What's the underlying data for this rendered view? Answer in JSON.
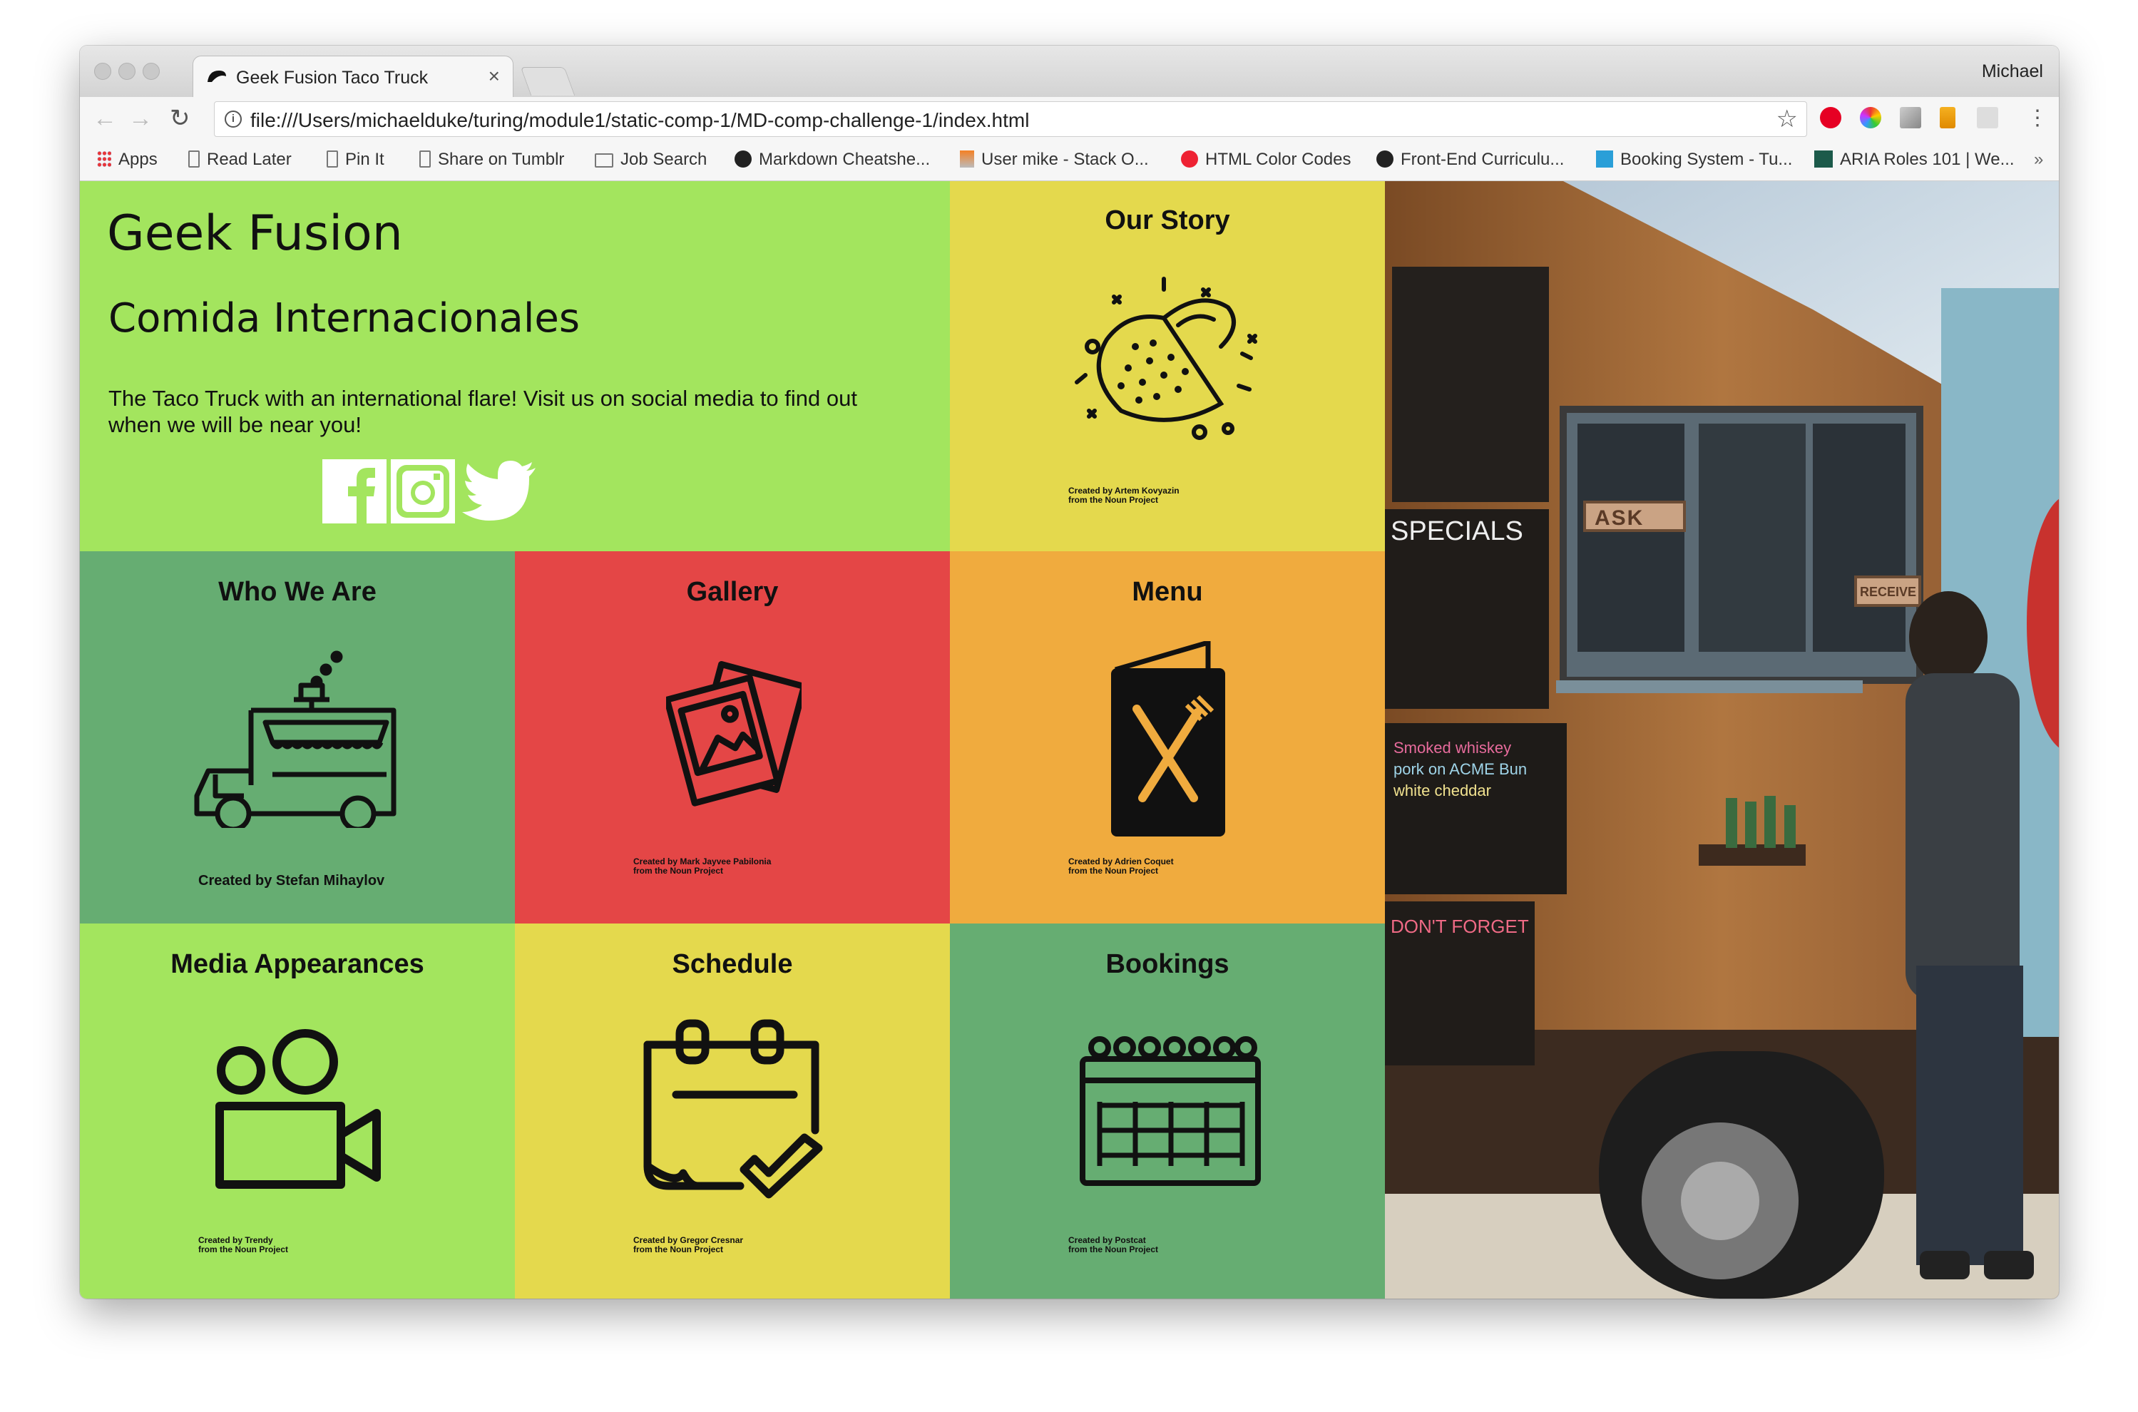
{
  "browser": {
    "tab_title": "Geek Fusion Taco Truck",
    "tab_close": "×",
    "profile": "Michael",
    "url": "file:///Users/michaelduke/turing/module1/static-comp-1/MD-comp-challenge-1/index.html",
    "bookmarks": [
      {
        "label": "Apps",
        "icon": "apps-grid-icon"
      },
      {
        "label": "Read Later",
        "icon": "page-icon"
      },
      {
        "label": "Pin It",
        "icon": "page-icon"
      },
      {
        "label": "Share on Tumblr",
        "icon": "page-icon"
      },
      {
        "label": "Job Search",
        "icon": "folder-icon"
      },
      {
        "label": "Markdown Cheatshe...",
        "icon": "github-icon"
      },
      {
        "label": "User mike - Stack O...",
        "icon": "stackoverflow-icon"
      },
      {
        "label": "HTML Color Codes",
        "icon": "color-icon"
      },
      {
        "label": "Front-End Curriculu...",
        "icon": "turing-icon"
      },
      {
        "label": "Booking System - Tu...",
        "icon": "calendar-icon"
      },
      {
        "label": "ARIA Roles 101 | We...",
        "icon": "wt-icon"
      }
    ],
    "bookmarks_overflow": "»"
  },
  "page": {
    "hero": {
      "title": "Geek Fusion",
      "subtitle": "Comida Internacionales",
      "tagline": "The Taco Truck with an international flare! Visit us on social media to find out when we will be near you!"
    },
    "tiles": {
      "our_story": {
        "title": "Our Story",
        "credit_line1": "Created by Artem Kovyazin",
        "credit_line2": "from the Noun Project"
      },
      "who_we_are": {
        "title": "Who We Are",
        "credit_line1": "Created by Stefan Mihaylov"
      },
      "gallery": {
        "title": "Gallery",
        "credit_line1": "Created by Mark Jayvee Pabilonia",
        "credit_line2": "from the Noun Project"
      },
      "menu": {
        "title": "Menu",
        "credit_line1": "Created by Adrien Coquet",
        "credit_line2": "from the Noun Project"
      },
      "media": {
        "title": "Media Appearances",
        "credit_line1": "Created by Trendy",
        "credit_line2": "from the Noun Project"
      },
      "schedule": {
        "title": "Schedule",
        "credit_line1": "Created by Gregor Cresnar",
        "credit_line2": "from the Noun Project"
      },
      "bookings": {
        "title": "Bookings",
        "credit_line1": "Created by Postcat",
        "credit_line2": "from the Noun Project"
      }
    },
    "photo_signs": {
      "ask": "ASK",
      "receive": "RECEIVE",
      "specials": "SPECIALS",
      "chalk_1": "Smoked whiskey",
      "chalk_2": "pork on ACME Bun",
      "chalk_3": "white cheddar",
      "chalk_4": "DON'T FORGET"
    },
    "colors": {
      "lime": "#a3e55e",
      "yellow": "#e4d94d",
      "green": "#66ad72",
      "red": "#e44646",
      "orange": "#f0ab3e"
    }
  }
}
